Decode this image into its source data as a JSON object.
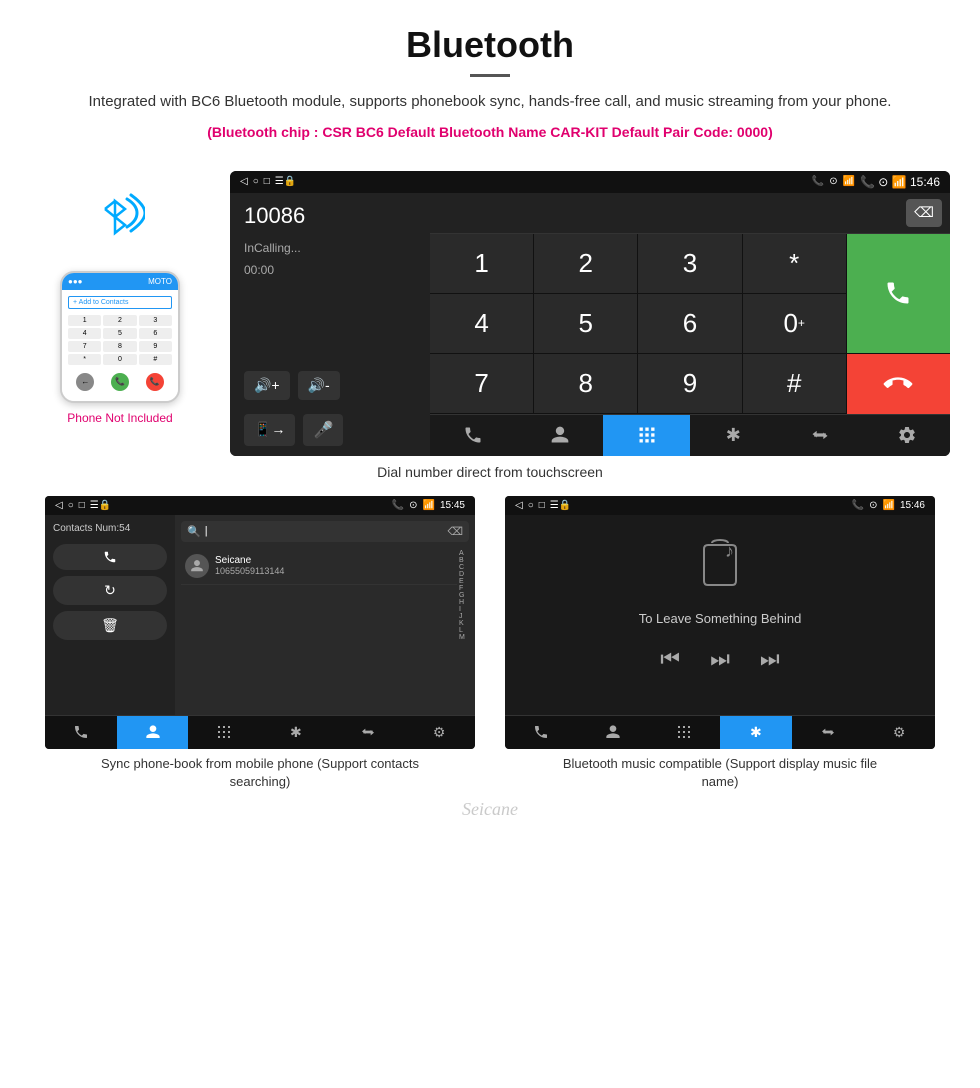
{
  "header": {
    "title": "Bluetooth",
    "description": "Integrated with BC6 Bluetooth module, supports phonebook sync, hands-free call, and music streaming from your phone.",
    "spec_line": "(Bluetooth chip : CSR BC6    Default Bluetooth Name CAR-KIT    Default Pair Code: 0000)"
  },
  "phone_side": {
    "not_included_label": "Phone Not Included",
    "dialpad_keys": [
      "1",
      "2",
      "3",
      "4",
      "5",
      "6",
      "7",
      "8",
      "9",
      "*",
      "0",
      "#"
    ]
  },
  "dial_screen": {
    "status_bar": {
      "left_icons": "◁  ○  □  ☰🔒",
      "right_icons": "📞 ⊙ 📶 15:46"
    },
    "number_display": "10086",
    "calling_status": "InCalling...",
    "timer": "00:00",
    "numpad": [
      "1",
      "2",
      "3",
      "*",
      "4",
      "5",
      "6",
      "0+",
      "7",
      "8",
      "9",
      "#"
    ],
    "caption": "Dial number direct from touchscreen"
  },
  "contacts_screen": {
    "contacts_num": "Contacts Num:54",
    "contact_name": "Seicane",
    "contact_phone": "10655059113144",
    "alpha_letters": [
      "A",
      "B",
      "C",
      "D",
      "E",
      "F",
      "G",
      "H",
      "I",
      "J",
      "K",
      "L",
      "M"
    ],
    "bottom_caption": "Sync phone-book from mobile phone\n(Support contacts searching)"
  },
  "music_screen": {
    "song_title": "To Leave Something Behind",
    "bottom_caption": "Bluetooth music compatible\n(Support display music file name)"
  },
  "nav_items": {
    "phone": "📞",
    "contacts": "👤",
    "dialpad": "⊞",
    "bluetooth": "✱",
    "transfer": "⬒",
    "settings": "⚙"
  },
  "watermark": "Seicane"
}
